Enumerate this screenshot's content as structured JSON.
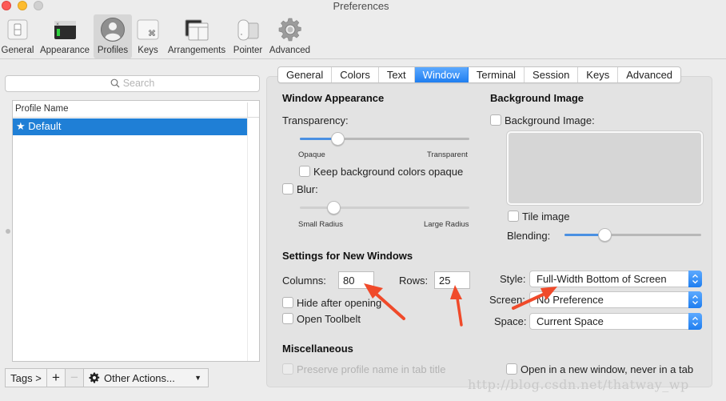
{
  "window": {
    "title": "Preferences",
    "traffic_lights": [
      "close",
      "minimize",
      "zoom"
    ]
  },
  "toolbar": {
    "items": [
      {
        "label": "General",
        "icon": "general-switch-icon",
        "active": false
      },
      {
        "label": "Appearance",
        "icon": "appearance-window-icon",
        "active": false
      },
      {
        "label": "Profiles",
        "icon": "profiles-person-icon",
        "active": true
      },
      {
        "label": "Keys",
        "icon": "keys-command-icon",
        "active": false
      },
      {
        "label": "Arrangements",
        "icon": "arrangements-windows-icon",
        "active": false
      },
      {
        "label": "Pointer",
        "icon": "pointer-mouse-icon",
        "active": false
      },
      {
        "label": "Advanced",
        "icon": "advanced-gear-icon",
        "active": false
      }
    ]
  },
  "profiles": {
    "search_placeholder": "Search",
    "column_header": "Profile Name",
    "rows": [
      {
        "name": "Default",
        "is_default": true,
        "selected": true,
        "display": "★ Default"
      }
    ],
    "bottom_bar": {
      "tags": "Tags >",
      "add": "+",
      "remove": "−",
      "other_actions": "Other Actions...",
      "chevron": "⌄"
    }
  },
  "tabs": {
    "items": [
      "General",
      "Colors",
      "Text",
      "Window",
      "Terminal",
      "Session",
      "Keys",
      "Advanced"
    ],
    "active": "Window"
  },
  "window_appearance": {
    "title": "Window Appearance",
    "transparency_label": "Transparency:",
    "transparency_value": 0.22,
    "transparency_min_label": "Opaque",
    "transparency_max_label": "Transparent",
    "keep_bg_opaque_label": "Keep background colors opaque",
    "keep_bg_opaque_checked": false,
    "blur_label": "Blur:",
    "blur_checked": false,
    "blur_value": 0.2,
    "blur_min_label": "Small Radius",
    "blur_max_label": "Large Radius"
  },
  "background_image": {
    "title": "Background Image",
    "enable_label": "Background Image:",
    "enable_checked": false,
    "tile_label": "Tile image",
    "tile_checked": false,
    "blending_label": "Blending:",
    "blending_value": 0.29
  },
  "new_windows": {
    "title": "Settings for New Windows",
    "columns_label": "Columns:",
    "columns_value": "80",
    "rows_label": "Rows:",
    "rows_value": "25",
    "hide_after_opening_label": "Hide after opening",
    "hide_after_opening_checked": false,
    "open_toolbelt_label": "Open Toolbelt",
    "open_toolbelt_checked": false,
    "style_label": "Style:",
    "style_value": "Full-Width Bottom of Screen",
    "screen_label": "Screen:",
    "screen_value": "No Preference",
    "space_label": "Space:",
    "space_value": "Current Space"
  },
  "miscellaneous": {
    "title": "Miscellaneous",
    "preserve_name_label": "Preserve profile name in tab title",
    "preserve_name_checked": false,
    "preserve_name_disabled": true,
    "open_new_window_label": "Open in a new window, never in a tab",
    "open_new_window_checked": false
  },
  "annotations": {
    "arrow_color": "#f04a2a"
  },
  "watermark": "http://blog.csdn.net/thatway_wp",
  "colors": {
    "accent": "#1f7fd6",
    "tab_active": "#2d89f5",
    "panel_bg": "#e3e3e3",
    "window_bg": "#ececec"
  }
}
